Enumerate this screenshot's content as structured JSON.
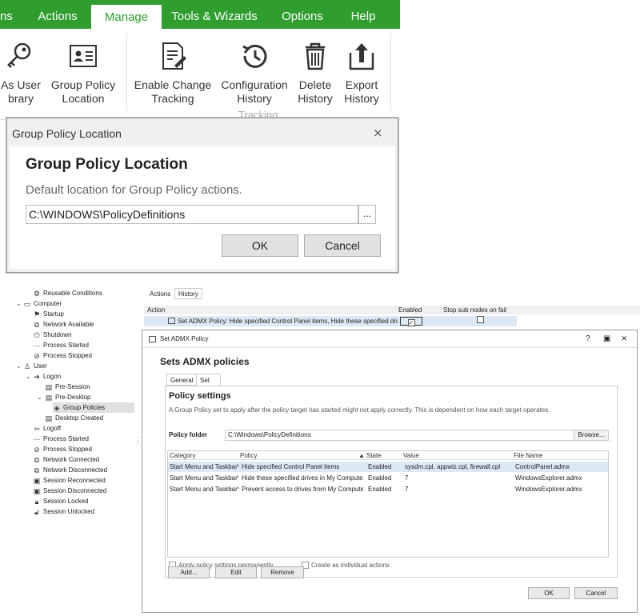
{
  "ribbon": {
    "tabs": [
      "ns",
      "Actions",
      "Manage",
      "Tools & Wizards",
      "Options",
      "Help"
    ],
    "active_tab": "Manage",
    "accent": "#2f9e2f",
    "buttons": [
      {
        "label": "As User\nbrary",
        "icon": "key-icon"
      },
      {
        "label": "Group Policy\nLocation",
        "icon": "id-card-icon"
      },
      {
        "label": "Enable Change\nTracking",
        "icon": "document-edit-icon"
      },
      {
        "label": "Configuration\nHistory",
        "icon": "history-icon"
      },
      {
        "label": "Delete\nHistory",
        "icon": "trash-icon"
      },
      {
        "label": "Export\nHistory",
        "icon": "export-icon"
      }
    ],
    "group_label": "Tracking"
  },
  "gp_dialog": {
    "title": "Group Policy Location",
    "heading": "Group Policy Location",
    "description": "Default location for Group Policy actions.",
    "path": "C:\\WINDOWS\\PolicyDefinitions",
    "browse": "...",
    "ok": "OK",
    "cancel": "Cancel"
  },
  "tree": [
    {
      "label": "Reusable Conditions",
      "icon": "gear-icon"
    },
    {
      "label": "Computer",
      "icon": "monitor-icon"
    },
    {
      "label": "Startup",
      "icon": "startup-icon"
    },
    {
      "label": "Network Available",
      "icon": "network-icon"
    },
    {
      "label": "Shutdown",
      "icon": "power-icon"
    },
    {
      "label": "Process Started",
      "icon": "process-icon"
    },
    {
      "label": "Process Stopped",
      "icon": "stop-icon"
    },
    {
      "label": "User",
      "icon": "user-icon"
    },
    {
      "label": "Logon",
      "icon": "logon-icon"
    },
    {
      "label": "Pre-Session",
      "icon": "window-icon"
    },
    {
      "label": "Pre-Desktop",
      "icon": "window-icon"
    },
    {
      "label": "Group Policies",
      "icon": "policy-icon"
    },
    {
      "label": "Desktop Created",
      "icon": "window-icon"
    },
    {
      "label": "Logoff",
      "icon": "logoff-icon"
    },
    {
      "label": "Process Started",
      "icon": "process-icon"
    },
    {
      "label": "Process Stopped",
      "icon": "stop-icon"
    },
    {
      "label": "Network Connected",
      "icon": "network-icon"
    },
    {
      "label": "Network Disconnected",
      "icon": "network-icon"
    },
    {
      "label": "Session Reconnected",
      "icon": "session-icon"
    },
    {
      "label": "Session Disconnected",
      "icon": "session-icon"
    },
    {
      "label": "Session Locked",
      "icon": "lock-icon"
    },
    {
      "label": "Session Unlocked",
      "icon": "unlock-icon"
    }
  ],
  "panel": {
    "tabs": [
      "Actions",
      "History"
    ],
    "columns": [
      "Action",
      "Enabled",
      "Stop sub nodes on fail"
    ],
    "row": {
      "action": "Set ADMX Policy: Hide specified Control Panel items, Hide these specified dri...",
      "enabled": true,
      "stop": false
    }
  },
  "admx": {
    "title": "Set ADMX Policy",
    "heading": "Sets ADMX policies",
    "tabs": [
      "General",
      "Set Policy"
    ],
    "active_tab": "Set Policy",
    "section": "Policy settings",
    "description": "A Group Policy set to apply after the policy target has started might not apply correctly. This is dependent on how each target operates.",
    "folder_label": "Policy folder",
    "folder": "C:\\Windows\\PolicyDefinitions",
    "browse": "Browse...",
    "columns": [
      "Category",
      "Policy",
      "State",
      "Value",
      "File Name"
    ],
    "rows": [
      [
        "Start Menu and Taskbar\\",
        "Hide specified Control Panel items",
        "Enabled",
        "sysdm.cpl, appwiz.cpl, firewall.cpl",
        "ControlPanel.admx"
      ],
      [
        "Start Menu and Taskbar\\",
        "Hide these specified drives in My Computer",
        "Enabled",
        "7",
        "WindowsExplorer.admx"
      ],
      [
        "Start Menu and Taskbar\\",
        "Prevent access to drives from My Computer",
        "Enabled",
        "7",
        "WindowsExplorer.admx"
      ]
    ],
    "apply_permanently": "Apply policy settings permanently",
    "create_individual": "Create as individual actions",
    "add": "Add...",
    "edit": "Edit",
    "remove": "Remove",
    "ok": "OK",
    "cancel": "Cancel"
  }
}
